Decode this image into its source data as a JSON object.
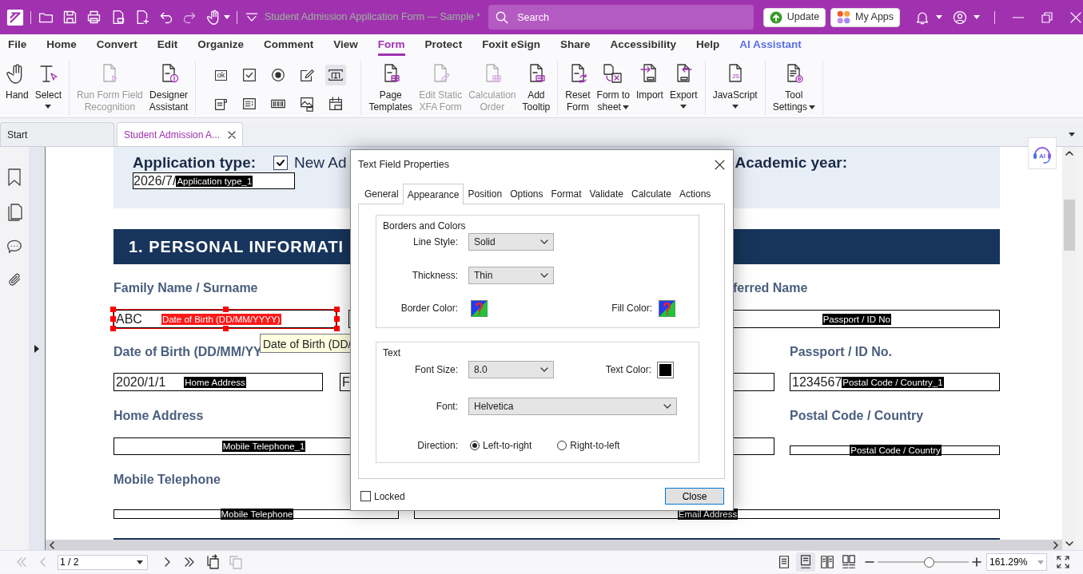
{
  "title_bar": {
    "document_title": "Student Admission Application Form — Sample *",
    "search": {
      "placeholder": "Search"
    },
    "update_button": "Update",
    "apps_button": "My Apps"
  },
  "menu_tabs": [
    {
      "label": "File",
      "selected": false,
      "kind": "tab"
    },
    {
      "label": "Home",
      "selected": false,
      "kind": "tab"
    },
    {
      "label": "Convert",
      "selected": false,
      "kind": "tab"
    },
    {
      "label": "Edit",
      "selected": false,
      "kind": "tab"
    },
    {
      "label": "Organize",
      "selected": false,
      "kind": "tab"
    },
    {
      "label": "Comment",
      "selected": false,
      "kind": "tab"
    },
    {
      "label": "View",
      "selected": false,
      "kind": "tab"
    },
    {
      "label": "Form",
      "selected": true,
      "kind": "tab"
    },
    {
      "label": "Protect",
      "selected": false,
      "kind": "tab"
    },
    {
      "label": "Foxit eSign",
      "selected": false,
      "kind": "tab"
    },
    {
      "label": "Share",
      "selected": false,
      "kind": "tab"
    },
    {
      "label": "Accessibility",
      "selected": false,
      "kind": "tab"
    },
    {
      "label": "Help",
      "selected": false,
      "kind": "tab"
    },
    {
      "label": "AI Assistant",
      "selected": false,
      "kind": "ai"
    }
  ],
  "ribbon": [
    {
      "items": [
        {
          "label": "Hand",
          "kind": "large",
          "disabled": false,
          "dropdown": false
        },
        {
          "label": "Select",
          "kind": "large",
          "disabled": false,
          "dropdown": true
        }
      ]
    },
    {
      "items": [
        {
          "label": "Run Form Field\nRecognition",
          "kind": "large",
          "disabled": true,
          "dropdown": false
        },
        {
          "label": "Designer\nAssistant",
          "kind": "large",
          "disabled": false,
          "dropdown": false
        }
      ]
    },
    {
      "items": [
        {
          "kind": "small",
          "selected": false,
          "icon_text": "ok"
        },
        {
          "kind": "small",
          "selected": false
        },
        {
          "kind": "small",
          "selected": false
        },
        {
          "kind": "small",
          "selected": false
        },
        {
          "kind": "small",
          "selected": true
        },
        {
          "kind": "small",
          "selected": false
        },
        {
          "kind": "small",
          "selected": false
        },
        {
          "kind": "small",
          "selected": false
        },
        {
          "kind": "small",
          "selected": false
        },
        {
          "kind": "small",
          "selected": false
        }
      ]
    },
    {
      "items": [
        {
          "label": "Page\nTemplates",
          "kind": "large",
          "disabled": false,
          "dropdown": false
        },
        {
          "label": "Edit Static\nXFA Form",
          "kind": "large",
          "disabled": true,
          "dropdown": false
        },
        {
          "label": "Calculation\nOrder",
          "kind": "large",
          "disabled": true,
          "dropdown": false
        },
        {
          "label": "Add\nTooltip",
          "kind": "large",
          "disabled": false,
          "dropdown": false
        }
      ]
    },
    {
      "items": [
        {
          "label": "Reset\nForm",
          "kind": "large",
          "disabled": false,
          "dropdown": false
        },
        {
          "label": "Form to\nsheet",
          "kind": "large",
          "disabled": false,
          "dropdown": true
        },
        {
          "label": "Import",
          "kind": "large",
          "disabled": false,
          "dropdown": false
        },
        {
          "label": "Export",
          "kind": "large",
          "disabled": false,
          "dropdown": true
        }
      ]
    },
    {
      "items": [
        {
          "label": "JavaScript",
          "kind": "large",
          "disabled": false,
          "dropdown": true,
          "icon_text": "JS"
        }
      ]
    },
    {
      "items": [
        {
          "label": "Tool\nSettings",
          "kind": "large",
          "disabled": false,
          "dropdown": true
        }
      ]
    }
  ],
  "document_tabs": [
    {
      "label": "Start",
      "selected": false,
      "closable": false
    },
    {
      "label": "Student Admission A...",
      "selected": true,
      "closable": true
    }
  ],
  "ai_helper": {
    "icon_text": "AI"
  },
  "document": {
    "application_type": {
      "label": "Application type:",
      "option": {
        "label": "New Ad",
        "checked": true
      },
      "year_label": "Academic year:",
      "field": {
        "value": "2026/7/",
        "tag": "Application type_1"
      }
    },
    "section_title": "1. PERSONAL INFORMATI",
    "fields": [
      {
        "label": "Family Name / Surname",
        "value": "ABC",
        "tag": "Date of Birth (DD/MM/YYYY)",
        "selected": true
      },
      {
        "label": "ferred Name",
        "tag": "Passport / ID No",
        "selected": false
      },
      {
        "label": "Date of Birth (DD/MM/YY",
        "value": "2020/1/1",
        "tag": "Home Address",
        "selected": false
      },
      {
        "value": "F",
        "selected": false
      },
      {
        "label": "Passport / ID No.",
        "value": "1234567",
        "tag": "Postal Code / Country_1",
        "selected": false
      },
      {
        "label": "Home Address",
        "tag": "Mobile Telephone_1",
        "selected": false
      },
      {
        "selected": false
      },
      {
        "label": "Postal Code / Country",
        "tag": "Postal Code / Country",
        "selected": false
      },
      {
        "label": "Mobile Telephone",
        "tag": "Mobile Telephone",
        "selected": false
      },
      {
        "tag": "Email Address",
        "selected": false
      }
    ]
  },
  "tooltip": "Date of Birth (DD/",
  "dialog": {
    "title": "Text Field Properties",
    "tabs": [
      {
        "label": "General",
        "selected": false
      },
      {
        "label": "Appearance",
        "selected": true
      },
      {
        "label": "Position",
        "selected": false
      },
      {
        "label": "Options",
        "selected": false
      },
      {
        "label": "Format",
        "selected": false
      },
      {
        "label": "Validate",
        "selected": false
      },
      {
        "label": "Calculate",
        "selected": false
      },
      {
        "label": "Actions",
        "selected": false
      }
    ],
    "borders_and_colors": {
      "title": "Borders and Colors",
      "line_style": {
        "label": "Line Style:",
        "value": "Solid"
      },
      "thickness": {
        "label": "Thickness:",
        "value": "Thin"
      },
      "border_color": {
        "label": "Border Color:",
        "no_color": true
      },
      "fill_color": {
        "label": "Fill Color:",
        "no_color": true
      }
    },
    "text": {
      "title": "Text",
      "font_size": {
        "label": "Font Size:",
        "value": "8.0"
      },
      "text_color": {
        "label": "Text Color:",
        "no_color": false,
        "color": "#000000"
      },
      "font": {
        "label": "Font:",
        "value": "Helvetica"
      },
      "direction": {
        "label": "Direction:",
        "options": [
          {
            "label": "Left-to-right",
            "selected": true
          },
          {
            "label": "Right-to-left",
            "selected": false
          }
        ]
      }
    },
    "locked": {
      "label": "Locked",
      "checked": false
    },
    "close_button": "Close"
  },
  "status_bar": {
    "navigation": [
      {
        "disabled": true
      },
      {
        "disabled": true
      },
      {
        "disabled": false
      },
      {
        "disabled": false
      }
    ],
    "page": "1 / 2",
    "view_modes": [
      {
        "selected": false
      },
      {
        "selected": true
      },
      {
        "selected": false
      },
      {
        "selected": false
      }
    ],
    "zoom": {
      "level": 0.56,
      "value": "161.29%"
    }
  }
}
